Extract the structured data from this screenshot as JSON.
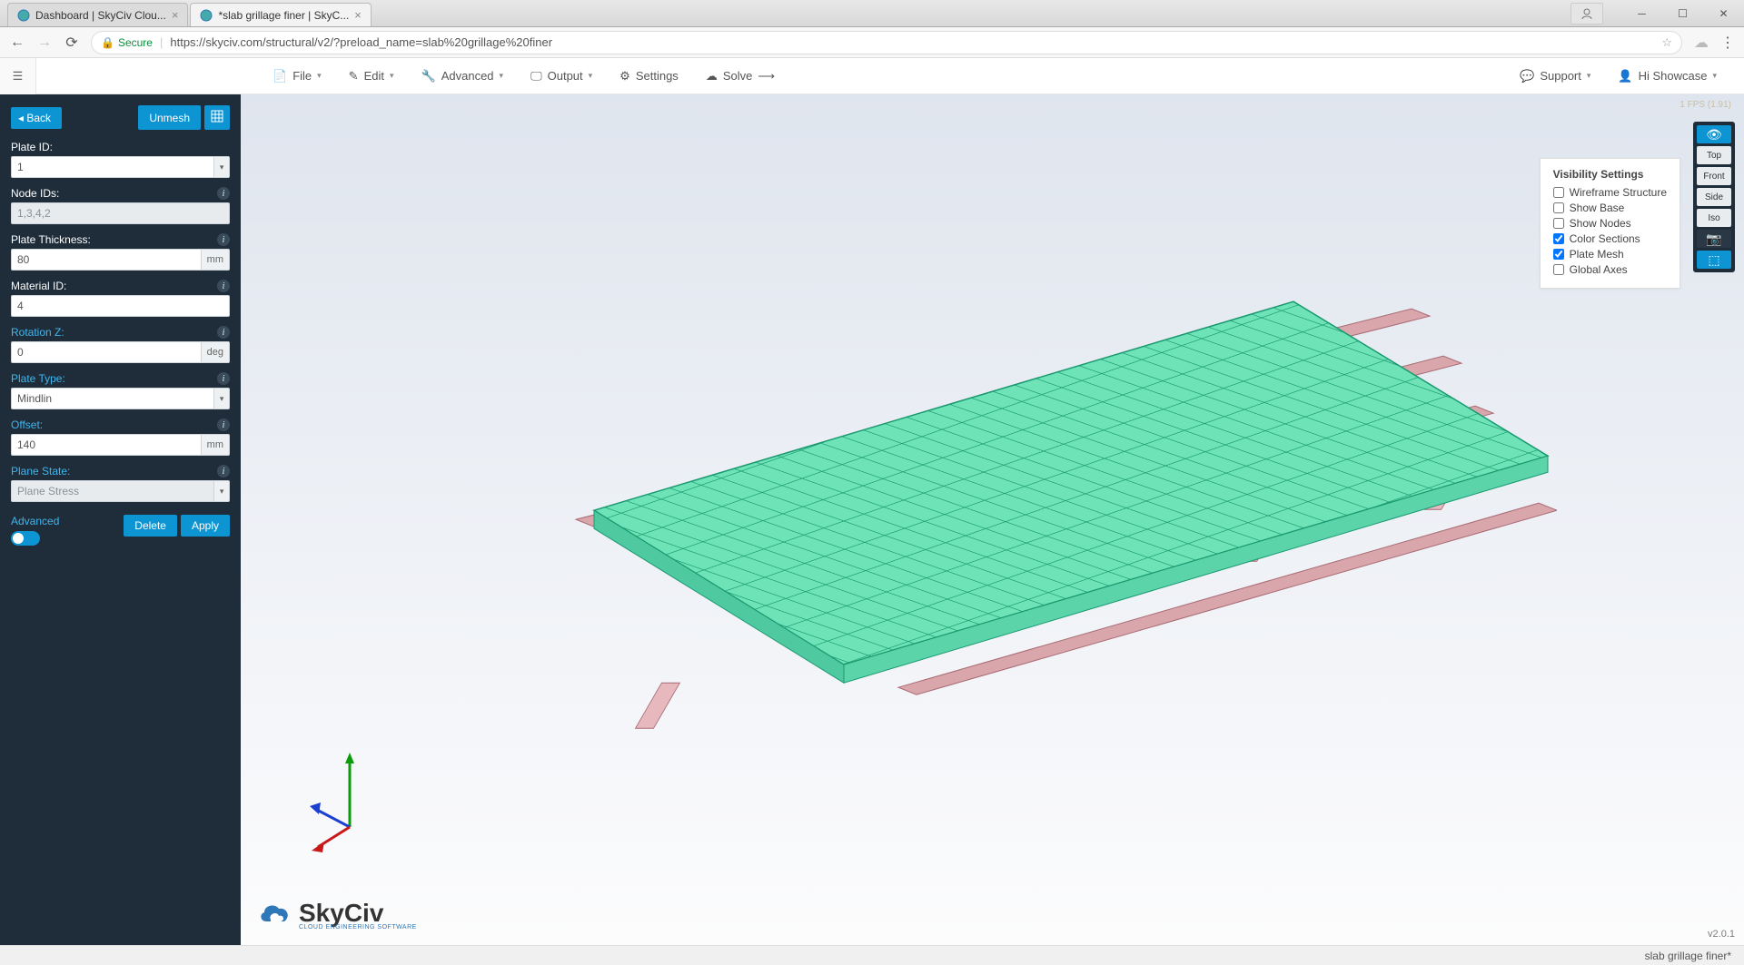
{
  "browser": {
    "tabs": [
      {
        "title": "Dashboard | SkyCiv Clou...",
        "active": false
      },
      {
        "title": "*slab grillage finer | SkyC...",
        "active": true
      }
    ],
    "secure_label": "Secure",
    "url": "https://skyciv.com/structural/v2/?preload_name=slab%20grillage%20finer"
  },
  "menu": {
    "file": "File",
    "edit": "Edit",
    "advanced": "Advanced",
    "output": "Output",
    "settings": "Settings",
    "solve": "Solve",
    "support": "Support",
    "user": "Hi Showcase"
  },
  "sidebar": {
    "back": "Back",
    "unmesh": "Unmesh",
    "plate_id_label": "Plate ID:",
    "plate_id_value": "1",
    "node_ids_label": "Node IDs:",
    "node_ids_value": "1,3,4,2",
    "thickness_label": "Plate Thickness:",
    "thickness_value": "80",
    "thickness_unit": "mm",
    "material_label": "Material ID:",
    "material_value": "4",
    "rotation_label": "Rotation Z:",
    "rotation_value": "0",
    "rotation_unit": "deg",
    "plate_type_label": "Plate Type:",
    "plate_type_value": "Mindlin",
    "offset_label": "Offset:",
    "offset_value": "140",
    "offset_unit": "mm",
    "plane_state_label": "Plane State:",
    "plane_state_value": "Plane Stress",
    "advanced_label": "Advanced",
    "delete": "Delete",
    "apply": "Apply"
  },
  "visibility": {
    "title": "Visibility Settings",
    "items": [
      {
        "label": "Wireframe Structure",
        "checked": false
      },
      {
        "label": "Show Base",
        "checked": false
      },
      {
        "label": "Show Nodes",
        "checked": false
      },
      {
        "label": "Color Sections",
        "checked": true
      },
      {
        "label": "Plate Mesh",
        "checked": true
      },
      {
        "label": "Global Axes",
        "checked": false
      }
    ]
  },
  "right_toolbar": {
    "top": "Top",
    "front": "Front",
    "side": "Side",
    "iso": "Iso"
  },
  "viewport": {
    "fps": "1 FPS (1.91)",
    "version": "v2.0.1",
    "logo_main": "SkyCiv",
    "logo_sub": "CLOUD ENGINEERING SOFTWARE"
  },
  "status": {
    "filename": "slab grillage finer*"
  }
}
